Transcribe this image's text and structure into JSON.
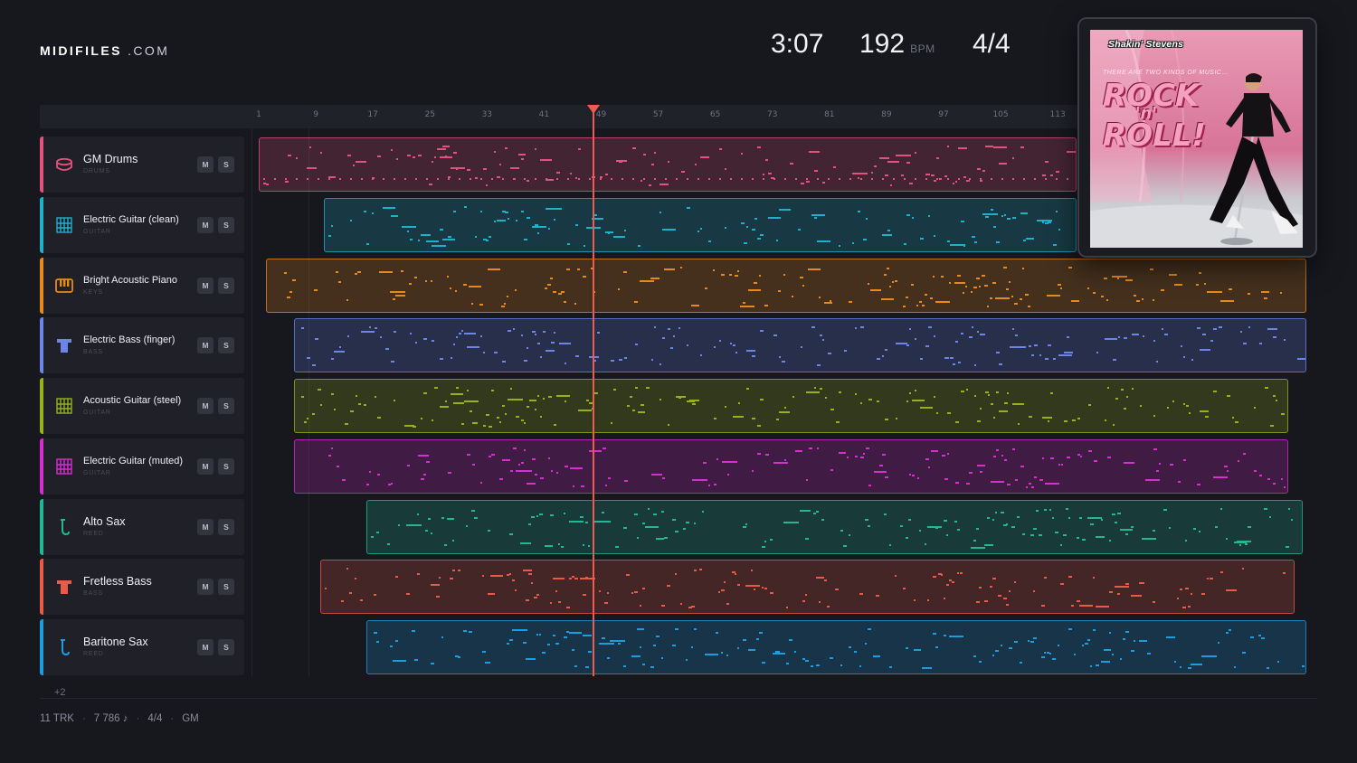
{
  "brand": {
    "bold": "MIDIFILES",
    "light": ".COM"
  },
  "header": {
    "duration": "3:07",
    "tempo": "192",
    "tempo_unit": "BPM",
    "time_signature": "4/4"
  },
  "timeline": {
    "ticks": [
      "1",
      "9",
      "17",
      "25",
      "33",
      "41",
      "49",
      "57",
      "65",
      "73",
      "81",
      "89",
      "97",
      "105",
      "113"
    ],
    "playhead_bar": 49
  },
  "tracks": [
    {
      "name": "GM Drums",
      "category": "DRUMS",
      "color": "#e2527e",
      "icon": "drum-icon",
      "mute": "M",
      "solo": "S"
    },
    {
      "name": "Electric Guitar (clean)",
      "category": "GUITAR",
      "color": "#1fb0cc",
      "icon": "guitar-fretboard-icon",
      "mute": "M",
      "solo": "S"
    },
    {
      "name": "Bright Acoustic Piano",
      "category": "KEYS",
      "color": "#e8891c",
      "icon": "piano-keys-icon",
      "mute": "M",
      "solo": "S"
    },
    {
      "name": "Electric Bass (finger)",
      "category": "BASS",
      "color": "#6b86e8",
      "icon": "bass-icon",
      "mute": "M",
      "solo": "S"
    },
    {
      "name": "Acoustic Guitar (steel)",
      "category": "GUITAR",
      "color": "#95b21a",
      "icon": "guitar-fretboard-icon",
      "mute": "M",
      "solo": "S"
    },
    {
      "name": "Electric Guitar (muted)",
      "category": "GUITAR",
      "color": "#d42fcf",
      "icon": "guitar-fretboard-icon",
      "mute": "M",
      "solo": "S"
    },
    {
      "name": "Alto Sax",
      "category": "REED",
      "color": "#21b894",
      "icon": "sax-icon",
      "mute": "M",
      "solo": "S"
    },
    {
      "name": "Fretless Bass",
      "category": "BASS",
      "color": "#ea5a45",
      "icon": "bass-icon",
      "mute": "M",
      "solo": "S"
    },
    {
      "name": "Baritone Sax",
      "category": "REED",
      "color": "#1e9ce0",
      "icon": "sax-icon",
      "mute": "M",
      "solo": "S"
    }
  ],
  "more_tracks": "+2",
  "footer": {
    "tracks": "11 TRK",
    "notes": "7 786 ♪",
    "time_signature": "4/4",
    "standard": "GM"
  },
  "cover": {
    "artist": "Shakin' Stevens",
    "tagline": "THERE ARE TWO KINDS OF MUSIC...",
    "title_line1": "ROCK",
    "title_line2": "'n'",
    "title_line3": "ROLL!"
  }
}
